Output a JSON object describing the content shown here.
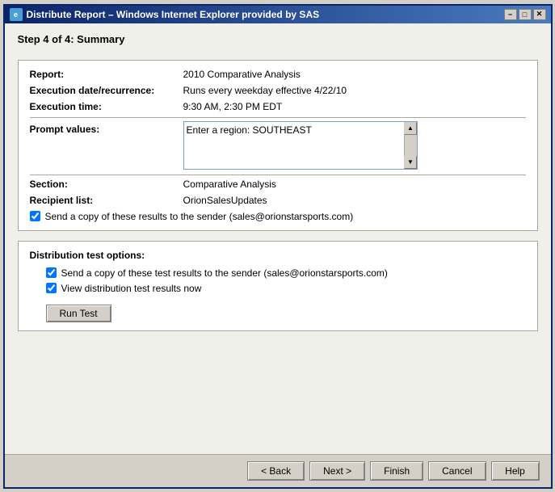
{
  "window": {
    "title": "Distribute Report – Windows Internet Explorer provided by SAS",
    "icon_label": "e"
  },
  "title_bar_controls": {
    "minimize": "−",
    "maximize": "□",
    "close": "✕"
  },
  "step": {
    "label": "Step 4 of 4: Summary"
  },
  "info": {
    "report_label": "Report:",
    "report_value": "2010 Comparative Analysis",
    "execution_label": "Execution date/recurrence:",
    "execution_value": "Runs every weekday effective 4/22/10",
    "time_label": "Execution time:",
    "time_value": "9:30 AM, 2:30 PM EDT",
    "prompt_label": "Prompt values:",
    "prompt_value": "Enter a region: SOUTHEAST",
    "section_label": "Section:",
    "section_value": "Comparative Analysis",
    "recipient_label": "Recipient list:",
    "recipient_value": "OrionSalesUpdates",
    "send_copy_label": "Send a copy of these results to the sender (sales@orionstarsports.com)"
  },
  "distribution": {
    "title": "Distribution test options:",
    "send_test_label": "Send a copy of these test results to the sender (sales@orionstarsports.com)",
    "view_results_label": "View distribution test results now",
    "run_test_label": "Run Test"
  },
  "footer": {
    "back_label": "< Back",
    "next_label": "Next >",
    "finish_label": "Finish",
    "cancel_label": "Cancel",
    "help_label": "Help"
  }
}
